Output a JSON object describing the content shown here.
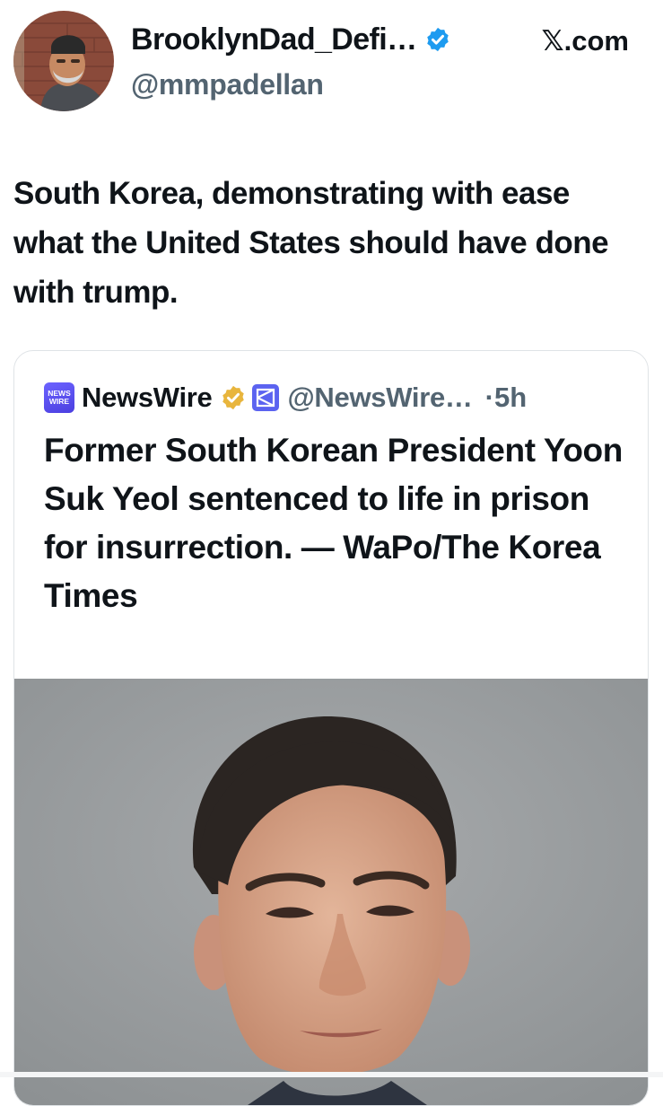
{
  "author": {
    "display_name": "BrooklynDad_Defi…",
    "handle": "@mmpadellan",
    "verified_icon": "verified-badge-icon",
    "avatar": "profile-avatar"
  },
  "brand": "𝕏.com",
  "tweet": {
    "text": "South Korea, demonstrating with ease what the United States should have done with trump."
  },
  "quoted": {
    "logo_text_top": "NEWS",
    "logo_text_bottom": "WIRE",
    "name": "NewsWire",
    "handle": "@NewsWire…",
    "dot": "·",
    "time": "5h",
    "badge_icon": "gold-verified-badge-icon",
    "affiliate_icon": "affiliate-logo-icon",
    "text": "Former South Korean President Yoon Suk Yeol sentenced to life in prison for insurrection. — WaPo/The Korea Times",
    "image": "portrait-photo"
  },
  "colors": {
    "text": "#0f1419",
    "secondary": "#536471",
    "verified_blue": "#1d9bf0",
    "gold": "#e8b53d",
    "newswire_purple": "#5a4fe8"
  }
}
